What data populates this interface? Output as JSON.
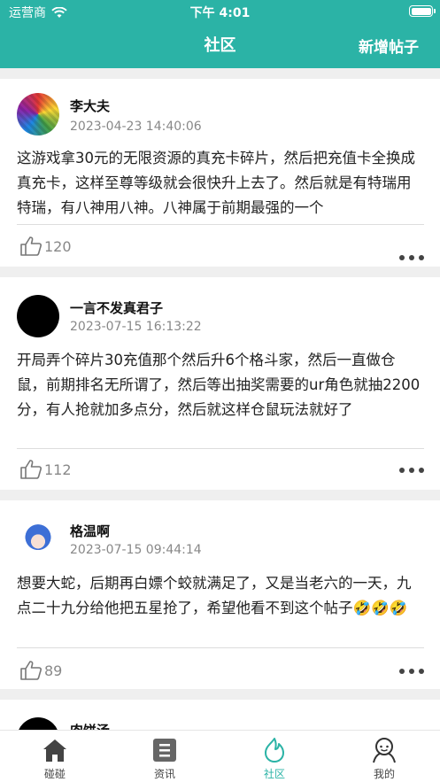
{
  "status_bar": {
    "carrier": "运营商",
    "time": "下午 4:01"
  },
  "nav": {
    "title": "社区",
    "action": "新增帖子"
  },
  "posts": [
    {
      "author": "李大夫",
      "date": "2023-04-23 14:40:06",
      "content": "这游戏拿30元的无限资源的真充卡碎片，然后把充值卡全换成真充卡，这样至尊等级就会很快升上去了。然后就是有特瑞用特瑞，有八神用八神。八神属于前期最强的一个",
      "likes": "120"
    },
    {
      "author": "一言不发真君子",
      "date": "2023-07-15 16:13:22",
      "content": "开局弄个碎片30充值那个然后升6个格斗家，然后一直做仓鼠，前期排名无所谓了，然后等出抽奖需要的ur角色就抽2200分，有人抢就加多点分，然后就这样仓鼠玩法就好了",
      "likes": "112"
    },
    {
      "author": "格温啊",
      "date": "2023-07-15 09:44:14",
      "content": "想要大蛇，后期再白嫖个蛟就满足了，又是当老六的一天，九点二十九分给他把五星抢了，希望他看不到这个帖子🤣🤣🤣",
      "likes": "89"
    },
    {
      "author": "肉饼汤",
      "date": "",
      "content": "",
      "likes": ""
    }
  ],
  "tabs": [
    {
      "label": "碰碰",
      "icon": "home-icon"
    },
    {
      "label": "资讯",
      "icon": "news-icon"
    },
    {
      "label": "社区",
      "icon": "community-icon",
      "active": true
    },
    {
      "label": "我的",
      "icon": "profile-icon"
    }
  ],
  "colors": {
    "accent": "#2bb3a6",
    "background": "#efefef"
  }
}
